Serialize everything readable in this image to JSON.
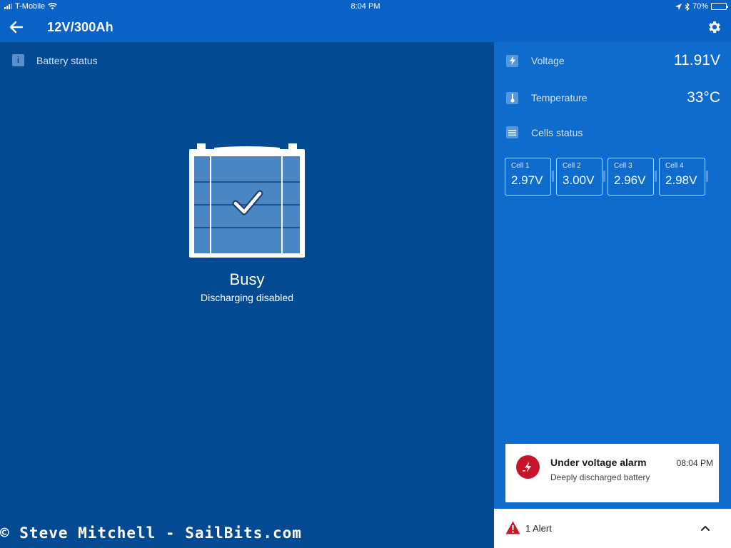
{
  "status_bar": {
    "carrier": "T-Mobile",
    "time": "8:04 PM",
    "battery_percent": "70%",
    "battery_level": 0.7,
    "icons": [
      "signal-icon",
      "wifi-icon",
      "location-icon",
      "bluetooth-icon",
      "battery-icon"
    ]
  },
  "app_bar": {
    "title": "12V/300Ah",
    "back_icon": "arrow-left-icon",
    "settings_icon": "gear-icon"
  },
  "left_panel": {
    "section_label": "Battery status",
    "section_icon": "info-icon",
    "battery_icon": "battery-check-icon",
    "status": "Busy",
    "sub_status": "Discharging disabled"
  },
  "right_panel": {
    "voltage": {
      "label": "Voltage",
      "value": "11.91V",
      "icon": "lightning-icon"
    },
    "temperature": {
      "label": "Temperature",
      "value": "33°C",
      "icon": "thermometer-icon"
    },
    "cells_status": {
      "label": "Cells status",
      "icon": "list-icon"
    },
    "cells": [
      {
        "name": "Cell 1",
        "voltage": "2.97V"
      },
      {
        "name": "Cell 2",
        "voltage": "3.00V"
      },
      {
        "name": "Cell 3",
        "voltage": "2.96V"
      },
      {
        "name": "Cell 4",
        "voltage": "2.98V"
      }
    ]
  },
  "alarm": {
    "title": "Under voltage alarm",
    "time": "08:04 PM",
    "description": "Deeply discharged battery",
    "icon": "low-voltage-icon"
  },
  "alert_bar": {
    "label": "1 Alert",
    "icon": "warning-triangle-icon",
    "toggle_icon": "chevron-up-icon"
  },
  "watermark": "© Steve Mitchell - SailBits.com",
  "colors": {
    "app_bar": "#0a62c7",
    "left_panel": "#034a93",
    "right_panel": "#0f6bcc",
    "alarm_red": "#c8152c"
  }
}
